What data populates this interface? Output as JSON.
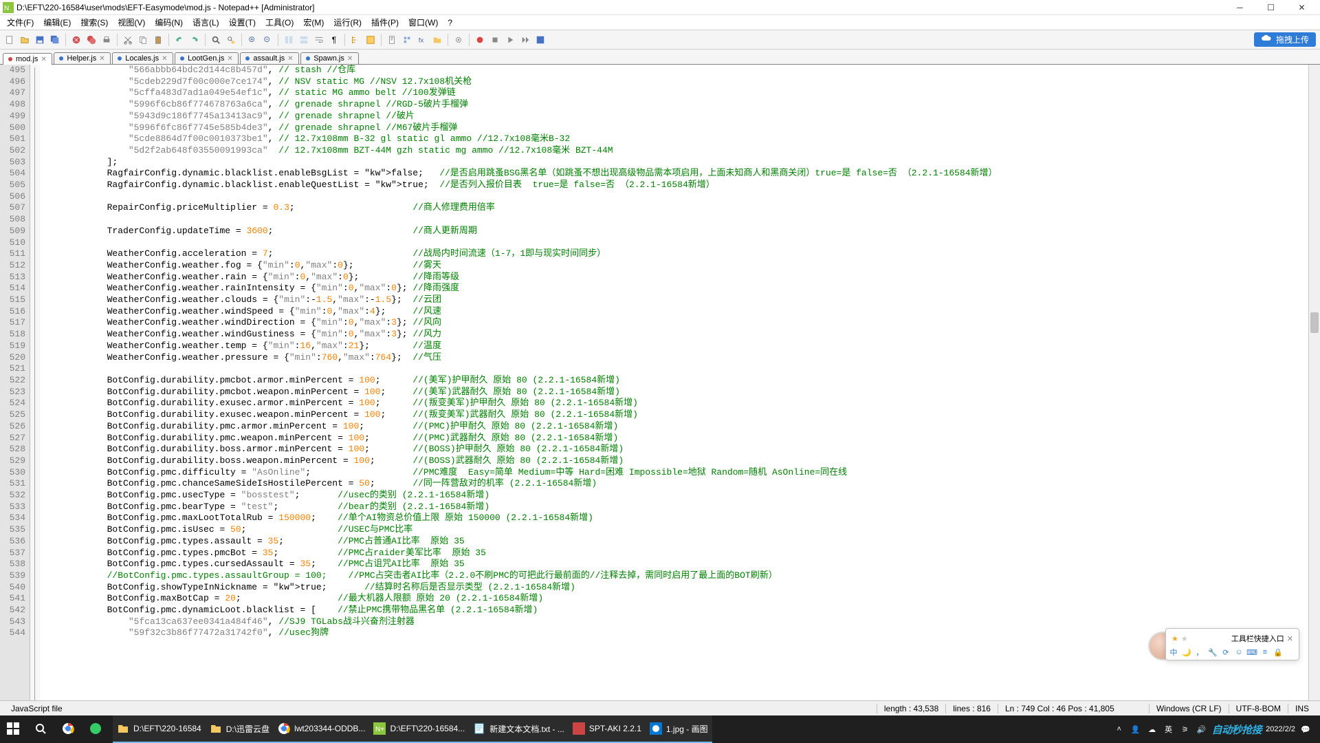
{
  "title": "D:\\EFT\\220-16584\\user\\mods\\EFT-Easymode\\mod.js - Notepad++ [Administrator]",
  "menu": [
    "文件(F)",
    "编辑(E)",
    "搜索(S)",
    "视图(V)",
    "编码(N)",
    "语言(L)",
    "设置(T)",
    "工具(O)",
    "宏(M)",
    "运行(R)",
    "插件(P)",
    "窗口(W)",
    "?"
  ],
  "upload_label": "拖拽上传",
  "tabs": [
    {
      "label": "mod.js",
      "active": true,
      "color": "#d04444"
    },
    {
      "label": "Helper.js",
      "active": false,
      "color": "#3a72c7"
    },
    {
      "label": "Locales.js",
      "active": false,
      "color": "#3a72c7"
    },
    {
      "label": "LootGen.js",
      "active": false,
      "color": "#3a72c7"
    },
    {
      "label": "assault.js",
      "active": false,
      "color": "#3a72c7"
    },
    {
      "label": "Spawn.js",
      "active": false,
      "color": "#3a72c7"
    }
  ],
  "first_line_no": 495,
  "code_lines": [
    {
      "t": "                \"566abbb64bdc2d144c8b457d\", // stash //仓库",
      "s": "cmtstr"
    },
    {
      "t": "                \"5cdeb229d7f00c000e7ce174\", // NSV static MG //NSV 12.7x108机关枪",
      "s": "cmtstr"
    },
    {
      "t": "                \"5cffa483d7ad1a049e54ef1c\", // static MG ammo belt //100发弹链",
      "s": "cmtstr"
    },
    {
      "t": "                \"5996f6cb86f774678763a6ca\", // grenade shrapnel //RGD-5破片手榴弹",
      "s": "cmtstr"
    },
    {
      "t": "                \"5943d9c186f7745a13413ac9\", // grenade shrapnel //破片",
      "s": "cmtstr"
    },
    {
      "t": "                \"5996f6fc86f7745e585b4de3\", // grenade shrapnel //M67破片手榴弹",
      "s": "cmtstr"
    },
    {
      "t": "                \"5cde8864d7f00c0010373be1\", // 12.7x108mm B-32 gl static gl ammo //12.7x108毫米B-32",
      "s": "cmtstr"
    },
    {
      "t": "                \"5d2f2ab648f03550091993ca\"  // 12.7x108mm BZT-44M gzh static mg ammo //12.7x108毫米 BZT-44M",
      "s": "cmtstr"
    },
    {
      "t": "            ];",
      "s": "plain"
    },
    {
      "t": "            RagfairConfig.dynamic.blacklist.enableBsgList = false;   //是否启用跳蚤BSG黑名单（如跳蚤不想出现高级物品需本项启用，上面未知商人和黑商关闭）true=是 false=否 （2.2.1-16584新增）",
      "s": "kwcmt"
    },
    {
      "t": "            RagfairConfig.dynamic.blacklist.enableQuestList = true;  //是否列入报价目表  true=是 false=否 （2.2.1-16584新增）",
      "s": "kwcmt"
    },
    {
      "t": "",
      "s": "plain"
    },
    {
      "t": "            RepairConfig.priceMultiplier = 0.3;                      //商人修理费用倍率",
      "s": "numcmt"
    },
    {
      "t": "",
      "s": "plain"
    },
    {
      "t": "            TraderConfig.updateTime = 3600;                          //商人更新周期",
      "s": "numcmt"
    },
    {
      "t": "",
      "s": "plain"
    },
    {
      "t": "            WeatherConfig.acceleration = 7;                          //战局内时间流速（1-7，1即与现实时间同步）",
      "s": "numcmt"
    },
    {
      "t": "            WeatherConfig.weather.fog = {\"min\":0,\"max\":0};           //雾天",
      "s": "objcmt"
    },
    {
      "t": "            WeatherConfig.weather.rain = {\"min\":0,\"max\":0};          //降雨等级",
      "s": "objcmt"
    },
    {
      "t": "            WeatherConfig.weather.rainIntensity = {\"min\":0,\"max\":0}; //降雨强度",
      "s": "objcmt"
    },
    {
      "t": "            WeatherConfig.weather.clouds = {\"min\":-1.5,\"max\":-1.5};  //云团",
      "s": "objcmt"
    },
    {
      "t": "            WeatherConfig.weather.windSpeed = {\"min\":0,\"max\":4};     //风速",
      "s": "objcmt"
    },
    {
      "t": "            WeatherConfig.weather.windDirection = {\"min\":0,\"max\":3}; //风向",
      "s": "objcmt"
    },
    {
      "t": "            WeatherConfig.weather.windGustiness = {\"min\":0,\"max\":3}; //风力",
      "s": "objcmt"
    },
    {
      "t": "            WeatherConfig.weather.temp = {\"min\":16,\"max\":21};        //温度",
      "s": "objcmt"
    },
    {
      "t": "            WeatherConfig.weather.pressure = {\"min\":760,\"max\":764};  //气压",
      "s": "objcmt"
    },
    {
      "t": "",
      "s": "plain"
    },
    {
      "t": "            BotConfig.durability.pmcbot.armor.minPercent = 100;      //(美军)护甲耐久 原始 80 (2.2.1-16584新增)",
      "s": "numcmt"
    },
    {
      "t": "            BotConfig.durability.pmcbot.weapon.minPercent = 100;     //(美军)武器耐久 原始 80 (2.2.1-16584新增)",
      "s": "numcmt"
    },
    {
      "t": "            BotConfig.durability.exusec.armor.minPercent = 100;      //(叛变美军)护甲耐久 原始 80 (2.2.1-16584新增)",
      "s": "numcmt"
    },
    {
      "t": "            BotConfig.durability.exusec.weapon.minPercent = 100;     //(叛变美军)武器耐久 原始 80 (2.2.1-16584新增)",
      "s": "numcmt"
    },
    {
      "t": "            BotConfig.durability.pmc.armor.minPercent = 100;         //(PMC)护甲耐久 原始 80 (2.2.1-16584新增)",
      "s": "numcmt"
    },
    {
      "t": "            BotConfig.durability.pmc.weapon.minPercent = 100;        //(PMC)武器耐久 原始 80 (2.2.1-16584新增)",
      "s": "numcmt"
    },
    {
      "t": "            BotConfig.durability.boss.armor.minPercent = 100;        //(BOSS)护甲耐久 原始 80 (2.2.1-16584新增)",
      "s": "numcmt"
    },
    {
      "t": "            BotConfig.durability.boss.weapon.minPercent = 100;       //(BOSS)武器耐久 原始 80 (2.2.1-16584新增)",
      "s": "numcmt"
    },
    {
      "t": "            BotConfig.pmc.difficulty = \"AsOnline\";                   //PMC难度  Easy=简单 Medium=中等 Hard=困难 Impossible=地狱 Random=随机 AsOnline=同在线",
      "s": "strcmt"
    },
    {
      "t": "            BotConfig.pmc.chanceSameSideIsHostilePercent = 50;       //同一阵营敌对的机率 (2.2.1-16584新增)",
      "s": "numcmt"
    },
    {
      "t": "            BotConfig.pmc.usecType = \"bosstest\";       //usec的类别 (2.2.1-16584新增)",
      "s": "strcmt"
    },
    {
      "t": "            BotConfig.pmc.bearType = \"test\";           //bear的类别 (2.2.1-16584新增)",
      "s": "strcmt"
    },
    {
      "t": "            BotConfig.pmc.maxLootTotalRub = 150000;    //单个AI物资总价值上限 原始 150000 (2.2.1-16584新增)",
      "s": "numcmt"
    },
    {
      "t": "            BotConfig.pmc.isUsec = 50;                 //USEC与PMC比率",
      "s": "numcmt"
    },
    {
      "t": "            BotConfig.pmc.types.assault = 35;          //PMC占普通AI比率  原始 35",
      "s": "numcmt"
    },
    {
      "t": "            BotConfig.pmc.types.pmcBot = 35;           //PMC占raider美军比率  原始 35",
      "s": "numcmt"
    },
    {
      "t": "            BotConfig.pmc.types.cursedAssault = 35;    //PMC占诅咒AI比率  原始 35",
      "s": "numcmt"
    },
    {
      "t": "            //BotConfig.pmc.types.assaultGroup = 100;    //PMC占突击者AI比率（2.2.0不刷PMC的可把此行最前面的//注释去掉，需同时启用了最上面的BOT刷新）",
      "s": "allcmt"
    },
    {
      "t": "            BotConfig.showTypeInNickname = true;       //结算时名称后是否显示类型 (2.2.1-16584新增)",
      "s": "kwcmt"
    },
    {
      "t": "            BotConfig.maxBotCap = 20;                  //最大机器人限额 原始 20 (2.2.1-16584新增)",
      "s": "numcmt"
    },
    {
      "t": "            BotConfig.pmc.dynamicLoot.blacklist = [    //禁止PMC携带物品黑名单 (2.2.1-16584新增)",
      "s": "numcmt"
    },
    {
      "t": "                \"5fca13ca637ee0341a484f46\", //SJ9 TGLabs战斗兴奋剂注射器",
      "s": "cmtstr"
    },
    {
      "t": "                \"59f32c3b86f77472a31742f0\", //usec狗牌",
      "s": "cmtstr"
    }
  ],
  "status": {
    "type": "JavaScript file",
    "length": "length : 43,538",
    "lines": "lines : 816",
    "pos": "Ln : 749   Col : 46   Pos : 41,805",
    "eol": "Windows (CR LF)",
    "enc": "UTF-8-BOM",
    "mode": "INS"
  },
  "taskbar_items": [
    {
      "label": "",
      "icon": "win"
    },
    {
      "label": "",
      "icon": "search"
    },
    {
      "label": "",
      "icon": "chrome"
    },
    {
      "label": "",
      "icon": "green"
    },
    {
      "label": "D:\\EFT\\220-16584",
      "icon": "folder",
      "running": true
    },
    {
      "label": "D:\\迅雷云盘",
      "icon": "folder",
      "running": true
    },
    {
      "label": "lwt203344-ODDB...",
      "icon": "chrome",
      "running": true
    },
    {
      "label": "D:\\EFT\\220-16584...",
      "icon": "npp",
      "running": true
    },
    {
      "label": "新建文本文档.txt - ...",
      "icon": "notepad",
      "running": true
    },
    {
      "label": "SPT-AKI 2.2.1",
      "icon": "spt",
      "running": true
    },
    {
      "label": "1.jpg - 画图",
      "icon": "paint",
      "running": true
    }
  ],
  "tray_time": "2022/2/2",
  "brand": "自动秒抢接",
  "float_title": "工具栏快捷入口"
}
